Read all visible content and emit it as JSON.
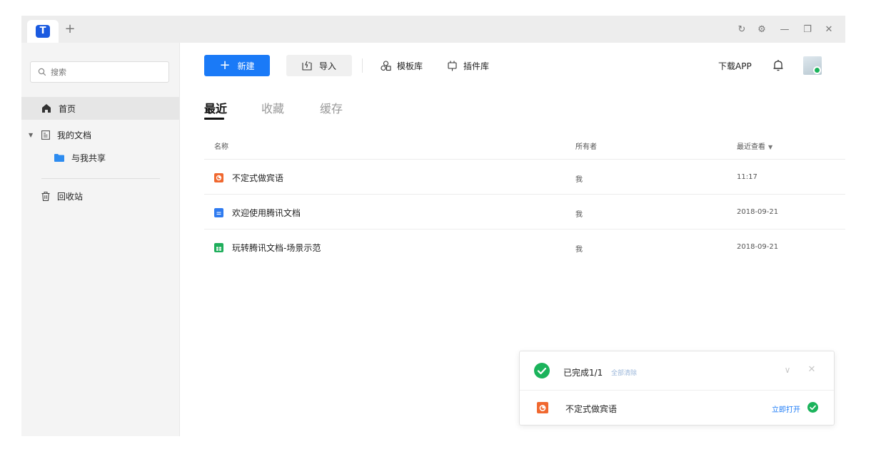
{
  "titlebar": {
    "logo_text": "T",
    "add_tab": "+",
    "controls": {
      "refresh": "↻",
      "settings": "⚙",
      "minimize": "—",
      "restore": "❐",
      "close": "✕"
    }
  },
  "sidebar": {
    "search_placeholder": "搜索",
    "items": [
      {
        "label": "首页",
        "icon": "home-icon"
      },
      {
        "label": "我的文档",
        "icon": "document-icon"
      },
      {
        "label": "与我共享",
        "icon": "folder-icon"
      },
      {
        "label": "回收站",
        "icon": "trash-icon"
      }
    ]
  },
  "toolbar": {
    "new_label": "新建",
    "new_plus": "+",
    "import_label": "导入",
    "templates_label": "模板库",
    "plugins_label": "插件库",
    "download_app_label": "下载APP"
  },
  "tabs": [
    "最近",
    "收藏",
    "缓存"
  ],
  "table": {
    "columns": {
      "name": "名称",
      "owner": "所有者",
      "viewed": "最近查看"
    },
    "sort_indicator": "▼",
    "rows": [
      {
        "name": "不定式做宾语",
        "owner": "我",
        "date": "11:17",
        "type": "slides"
      },
      {
        "name": "欢迎使用腾讯文档",
        "owner": "我",
        "date": "2018-09-21",
        "type": "doc"
      },
      {
        "name": "玩转腾讯文档-场景示范",
        "owner": "我",
        "date": "2018-09-21",
        "type": "sheet"
      }
    ]
  },
  "download_panel": {
    "status": "已完成1/1",
    "clear_all": "全部清除",
    "collapse": "∨",
    "close": "✕",
    "file_name": "不定式做宾语",
    "open_now": "立即打开"
  },
  "colors": {
    "primary": "#1a7af7",
    "success": "#1bb35b",
    "slides": "#f0682f",
    "doc": "#2f7bf0",
    "sheet": "#1fae5b"
  }
}
